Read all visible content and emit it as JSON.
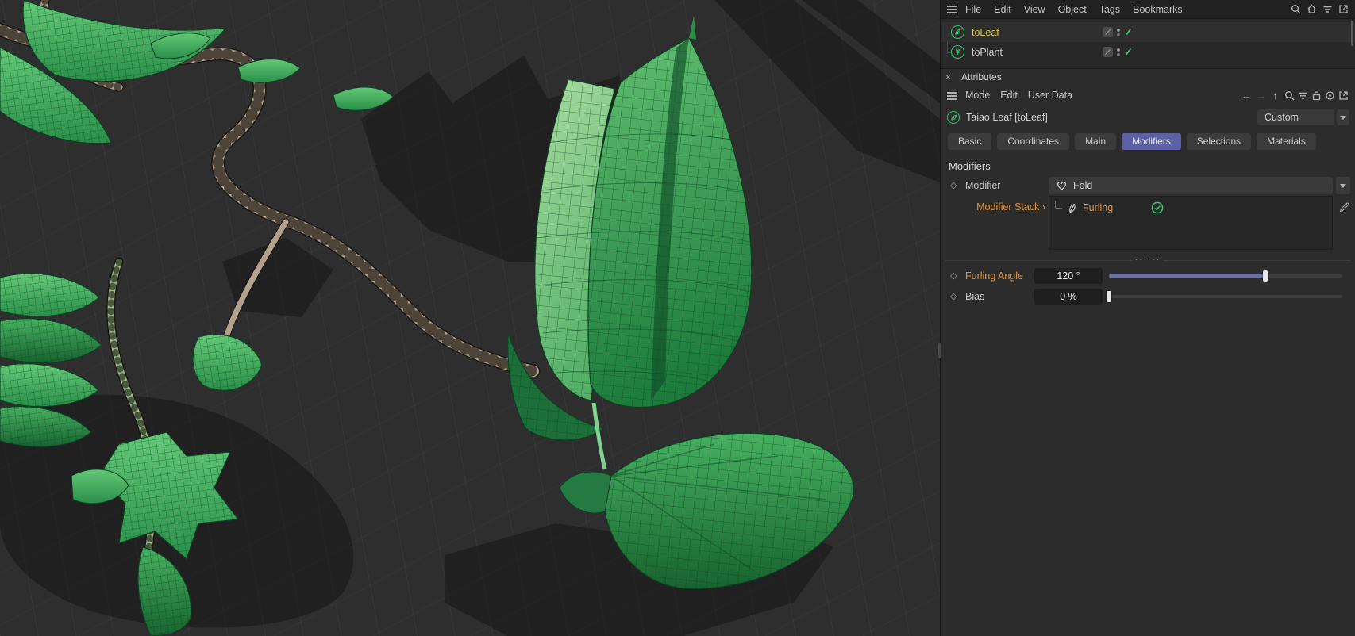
{
  "menu_bar": {
    "items": [
      "File",
      "Edit",
      "View",
      "Object",
      "Tags",
      "Bookmarks"
    ],
    "icons": [
      "search-icon",
      "home-icon",
      "filter-icon",
      "new-window-icon"
    ]
  },
  "object_manager": {
    "objects": [
      {
        "label": "toLeaf",
        "icon": "leaf-circle-icon",
        "selected": true,
        "enabled_glyph": "✓"
      },
      {
        "label": "toPlant",
        "icon": "plant-circle-icon",
        "selected": false,
        "enabled_glyph": "✓"
      }
    ]
  },
  "attributes_panel": {
    "close_glyph": "×",
    "title": "Attributes",
    "toolbar": {
      "items": [
        "Mode",
        "Edit",
        "User Data"
      ],
      "nav_glyphs": {
        "back": "←",
        "forward": "→",
        "up": "↑"
      },
      "icons": [
        "search-icon",
        "filter-icon",
        "lock-icon",
        "target-icon",
        "new-window-icon"
      ]
    },
    "object_name": "Taiao Leaf [toLeaf]",
    "preset": "Custom",
    "tabs": [
      "Basic",
      "Coordinates",
      "Main",
      "Modifiers",
      "Selections",
      "Materials"
    ],
    "active_tab": "Modifiers",
    "section_title": "Modifiers",
    "diamond_glyph": "◇",
    "splitter_dots": "······",
    "params": {
      "modifier": {
        "label": "Modifier",
        "value": "Fold"
      },
      "modifier_stack": {
        "label": "Modifier Stack",
        "chevron": "›",
        "item": "Furling"
      },
      "furling_angle": {
        "label": "Furling Angle",
        "value": "120 °",
        "percent": 67
      },
      "bias": {
        "label": "Bias",
        "value": "0 %",
        "percent": 0
      }
    }
  },
  "colors": {
    "accent_orange": "#e2953f",
    "selected_yellow": "#d8c64e",
    "active_tab_purple": "#5c60a4",
    "enable_green": "#49c46f",
    "slider_fill": "#6a6fb4",
    "leaf_green": "#4fae63",
    "branch_tan": "#b2a18d"
  }
}
